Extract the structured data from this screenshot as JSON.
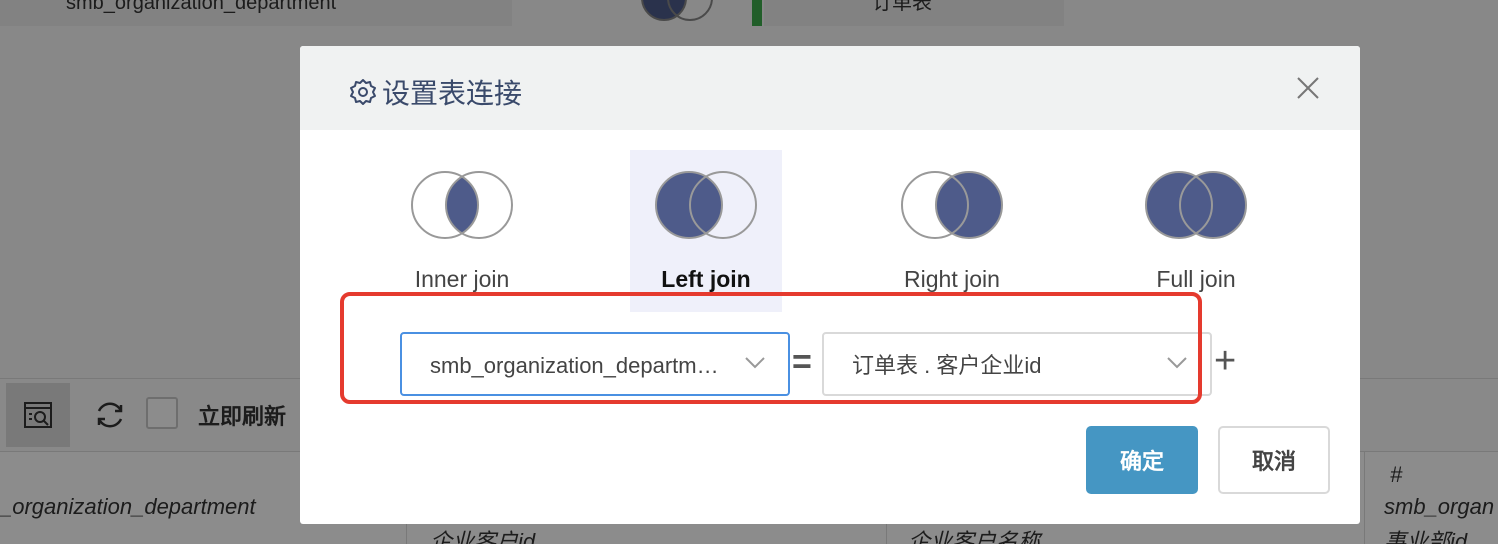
{
  "background": {
    "top_left_tab": "smb_organization_department",
    "top_right_tab": "订单表",
    "toolbar": {
      "refresh_now_label": "立即刷新"
    },
    "table": {
      "col1_header": "_organization_department",
      "col2_header": "企业客户id",
      "col3_header": "企业客户名称",
      "col4_type": "#",
      "col4_header": "smb_organ",
      "col4_sub": "事业部id"
    }
  },
  "modal": {
    "title": "设置表连接",
    "joins": [
      {
        "label": "Inner join",
        "selected": false
      },
      {
        "label": "Left join",
        "selected": true
      },
      {
        "label": "Right join",
        "selected": false
      },
      {
        "label": "Full join",
        "selected": false
      }
    ],
    "condition": {
      "left_value": "smb_organization_department.事业部id",
      "right_value": "订单表 . 客户企业id",
      "operator": "=",
      "add_label": "+"
    },
    "ok_label": "确定",
    "cancel_label": "取消"
  },
  "colors": {
    "accent_fill": "#4e5b8a",
    "primary_button": "#4596c3",
    "highlight_border": "#e53a2e",
    "focus_border": "#4a90e2"
  }
}
